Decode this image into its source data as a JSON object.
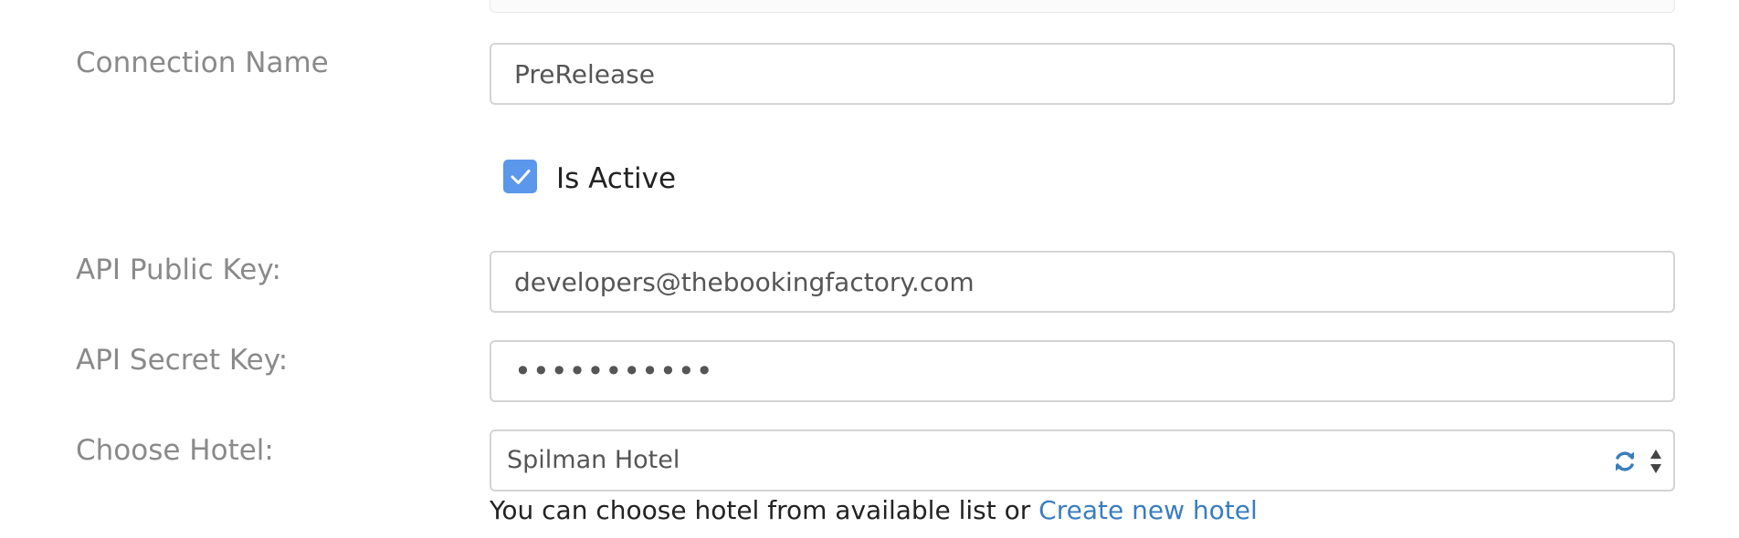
{
  "form": {
    "connection_name": {
      "label": "Connection Name",
      "value": "PreRelease"
    },
    "is_active": {
      "label": "Is Active",
      "checked": true
    },
    "api_public_key": {
      "label": "API Public Key:",
      "value": "developers@thebookingfactory.com"
    },
    "api_secret_key": {
      "label": "API Secret Key:",
      "value": "•••••••••••"
    },
    "hotel": {
      "label": "Choose Hotel:",
      "selected": "Spilman Hotel",
      "help_text": "You can choose hotel from available list or ",
      "create_link": "Create new hotel",
      "refresh_icon": "refresh-icon",
      "arrows_icon": "select-arrows-icon"
    }
  },
  "colors": {
    "checkbox": "#5b97ea",
    "link": "#3a7dbf",
    "refresh_icon": "#3a7dbf",
    "label": "#8a8a8a",
    "input_border": "#d4d4d4"
  }
}
